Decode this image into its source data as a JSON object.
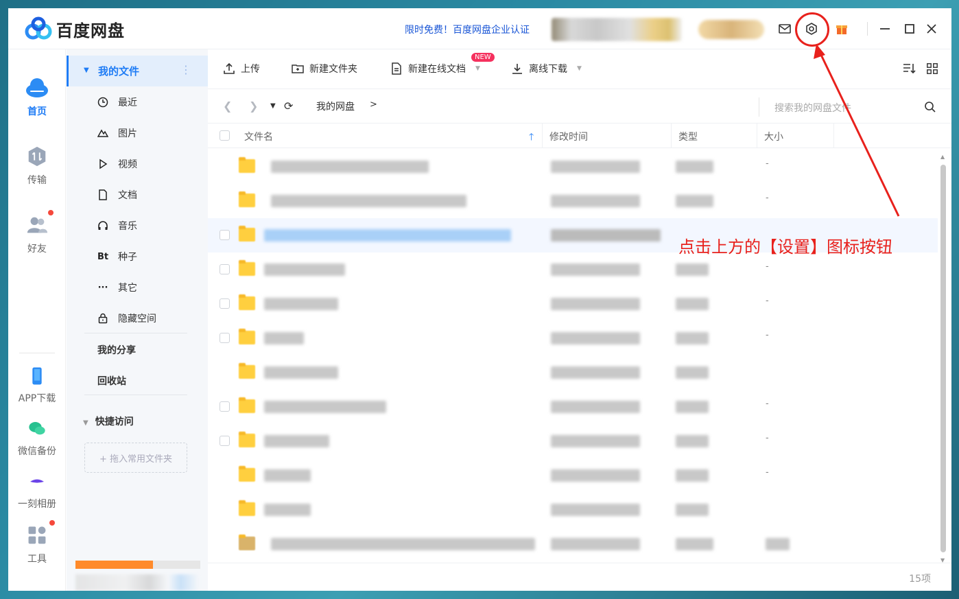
{
  "app": {
    "name": "百度网盘",
    "promo": "限时免费！百度网盘企业认证"
  },
  "leftnav": {
    "items": [
      {
        "label": "首页",
        "icon": "cloud-icon",
        "active": true
      },
      {
        "label": "传输",
        "icon": "transfer-icon"
      },
      {
        "label": "好友",
        "icon": "friends-icon"
      },
      {
        "label": "APP下载",
        "icon": "phone-icon"
      },
      {
        "label": "微信备份",
        "icon": "wechat-icon"
      },
      {
        "label": "一刻相册",
        "icon": "album-icon"
      },
      {
        "label": "工具",
        "icon": "tools-icon"
      }
    ]
  },
  "sidebar": {
    "my_files": "我的文件",
    "items": [
      {
        "label": "最近",
        "icon": "clock-icon"
      },
      {
        "label": "图片",
        "icon": "image-icon"
      },
      {
        "label": "视频",
        "icon": "play-icon"
      },
      {
        "label": "文档",
        "icon": "document-icon"
      },
      {
        "label": "音乐",
        "icon": "headphones-icon"
      },
      {
        "label": "种子",
        "icon": "bt-icon",
        "glyph": "Bt"
      },
      {
        "label": "其它",
        "icon": "more-icon",
        "glyph": "···"
      },
      {
        "label": "隐藏空间",
        "icon": "lock-icon"
      }
    ],
    "my_share": "我的分享",
    "recycle": "回收站",
    "quick_access": "快捷访问",
    "drop_hint": "+ 拖入常用文件夹"
  },
  "toolbar": {
    "upload": "上传",
    "new_folder": "新建文件夹",
    "new_online_doc": "新建在线文档",
    "new_badge": "NEW",
    "offline_download": "离线下载"
  },
  "path": {
    "current": "我的网盘",
    "separator": ">",
    "search_placeholder": "搜索我的网盘文件"
  },
  "table": {
    "headers": {
      "name": "文件名",
      "modified": "修改时间",
      "type": "类型",
      "size": "大小"
    },
    "rows": [
      {
        "size": "-"
      },
      {
        "size": "-"
      },
      {
        "size": ""
      },
      {
        "size": "-"
      },
      {
        "size": "-"
      },
      {
        "size": "-"
      },
      {
        "size": ""
      },
      {
        "size": "-"
      },
      {
        "size": "-"
      },
      {
        "size": "-"
      },
      {
        "size": ""
      },
      {
        "size": ""
      }
    ]
  },
  "footer": {
    "count": "15项"
  },
  "annotation": {
    "text": "点击上方的【设置】图标按钮",
    "color": "#e8211c"
  },
  "colors": {
    "accent": "#1f7cf5",
    "folder": "#ffcf3f",
    "quota_fill": "#ff8a2a"
  },
  "quota_used_fraction": 0.62
}
